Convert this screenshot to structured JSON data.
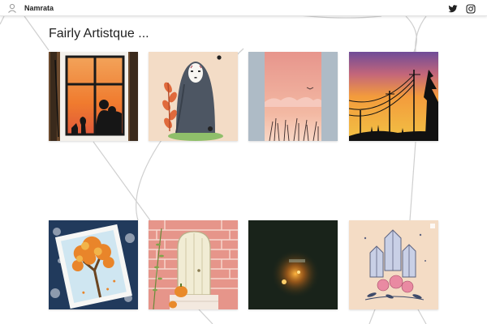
{
  "header": {
    "site_name": "Namrata",
    "avatar_icon": "user-icon",
    "social_icons": [
      "twitter-icon",
      "instagram-icon"
    ]
  },
  "gallery": {
    "title": "Fairly Artistque ...",
    "items": [
      {
        "id": "window-sunset",
        "desc": "silhouette window at sunset"
      },
      {
        "id": "no-face",
        "desc": "no face spirit"
      },
      {
        "id": "pink-sky",
        "desc": "pink sky with grass"
      },
      {
        "id": "power-lines",
        "desc": "sunset with power lines"
      },
      {
        "id": "autumn-tree",
        "desc": "autumn tree"
      },
      {
        "id": "brick-door",
        "desc": "brick wall with door"
      },
      {
        "id": "glowing-light",
        "desc": "dark with small glowing light"
      },
      {
        "id": "crystals",
        "desc": "crystals with roses"
      }
    ]
  }
}
